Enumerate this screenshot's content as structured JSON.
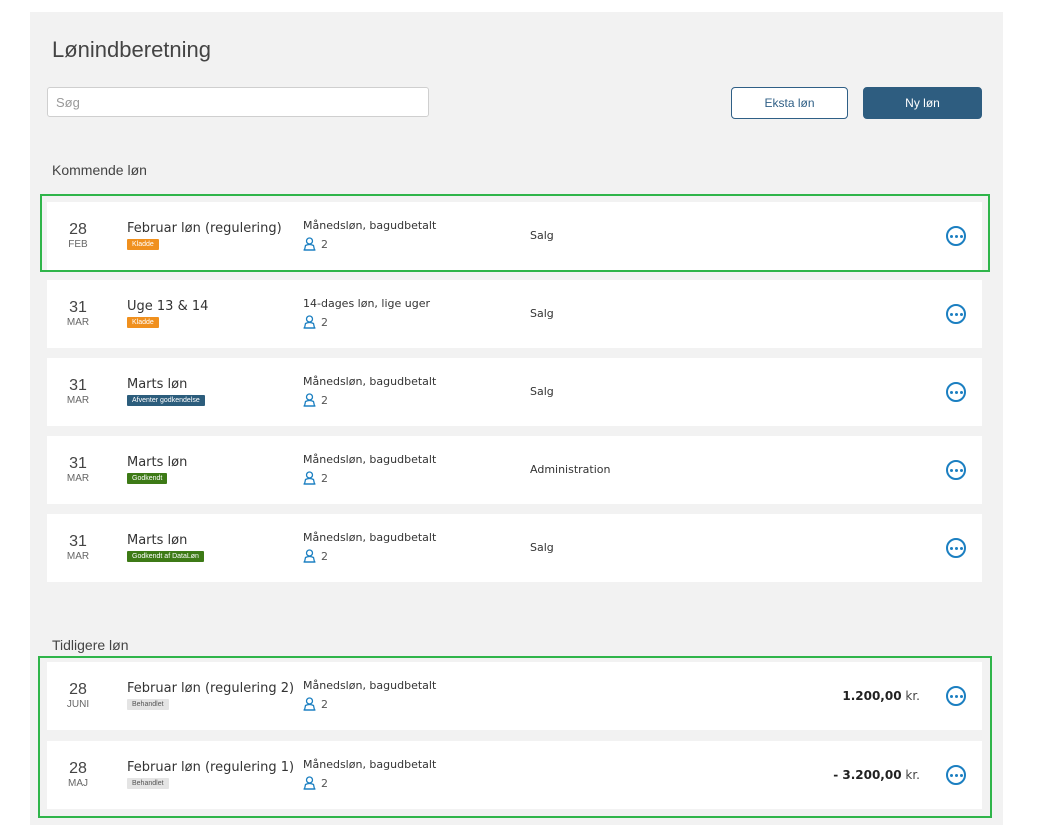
{
  "page": {
    "title": "Lønindberetning"
  },
  "search": {
    "placeholder": "Søg"
  },
  "actions": {
    "extra_label": "Eksta løn",
    "new_label": "Ny løn"
  },
  "upcoming": {
    "title": "Kommende løn",
    "rows": [
      {
        "day": "28",
        "month": "FEB",
        "name": "Februar løn (regulering)",
        "badge": "Kladde",
        "badge_color": "#f0901e",
        "badge_text_color": "#ffffff",
        "type": "Månedsløn, bagudbetalt",
        "employees": "2",
        "department": "Salg"
      },
      {
        "day": "31",
        "month": "MAR",
        "name": "Uge 13 & 14",
        "badge": "Kladde",
        "badge_color": "#f0901e",
        "badge_text_color": "#ffffff",
        "type": "14-dages løn, lige uger",
        "employees": "2",
        "department": "Salg"
      },
      {
        "day": "31",
        "month": "MAR",
        "name": "Marts løn",
        "badge": "Afventer godkendelse",
        "badge_color": "#2c5d7c",
        "badge_text_color": "#ffffff",
        "type": "Månedsløn, bagudbetalt",
        "employees": "2",
        "department": "Salg"
      },
      {
        "day": "31",
        "month": "MAR",
        "name": "Marts løn",
        "badge": "Godkendt",
        "badge_color": "#3d7a16",
        "badge_text_color": "#ffffff",
        "type": "Månedsløn, bagudbetalt",
        "employees": "2",
        "department": "Administration"
      },
      {
        "day": "31",
        "month": "MAR",
        "name": "Marts løn",
        "badge": "Godkendt af DataLøn",
        "badge_color": "#3d7a16",
        "badge_text_color": "#ffffff",
        "type": "Månedsløn, bagudbetalt",
        "employees": "2",
        "department": "Salg"
      }
    ]
  },
  "previous": {
    "title": "Tidligere løn",
    "rows": [
      {
        "day": "28",
        "month": "JUNI",
        "name": "Februar løn (regulering 2)",
        "badge": "Behandlet",
        "badge_color": "#e4e4e4",
        "badge_text_color": "#555555",
        "type": "Månedsløn, bagudbetalt",
        "employees": "2",
        "amount": "1.200,00",
        "currency": "kr."
      },
      {
        "day": "28",
        "month": "MAJ",
        "name": "Februar løn (regulering 1)",
        "badge": "Behandlet",
        "badge_color": "#e4e4e4",
        "badge_text_color": "#555555",
        "type": "Månedsløn, bagudbetalt",
        "employees": "2",
        "amount": "- 3.200,00",
        "currency": "kr."
      }
    ]
  },
  "colors": {
    "accent": "#2e5d80",
    "highlight": "#2fb54a",
    "icon_blue": "#1b7fc1"
  }
}
